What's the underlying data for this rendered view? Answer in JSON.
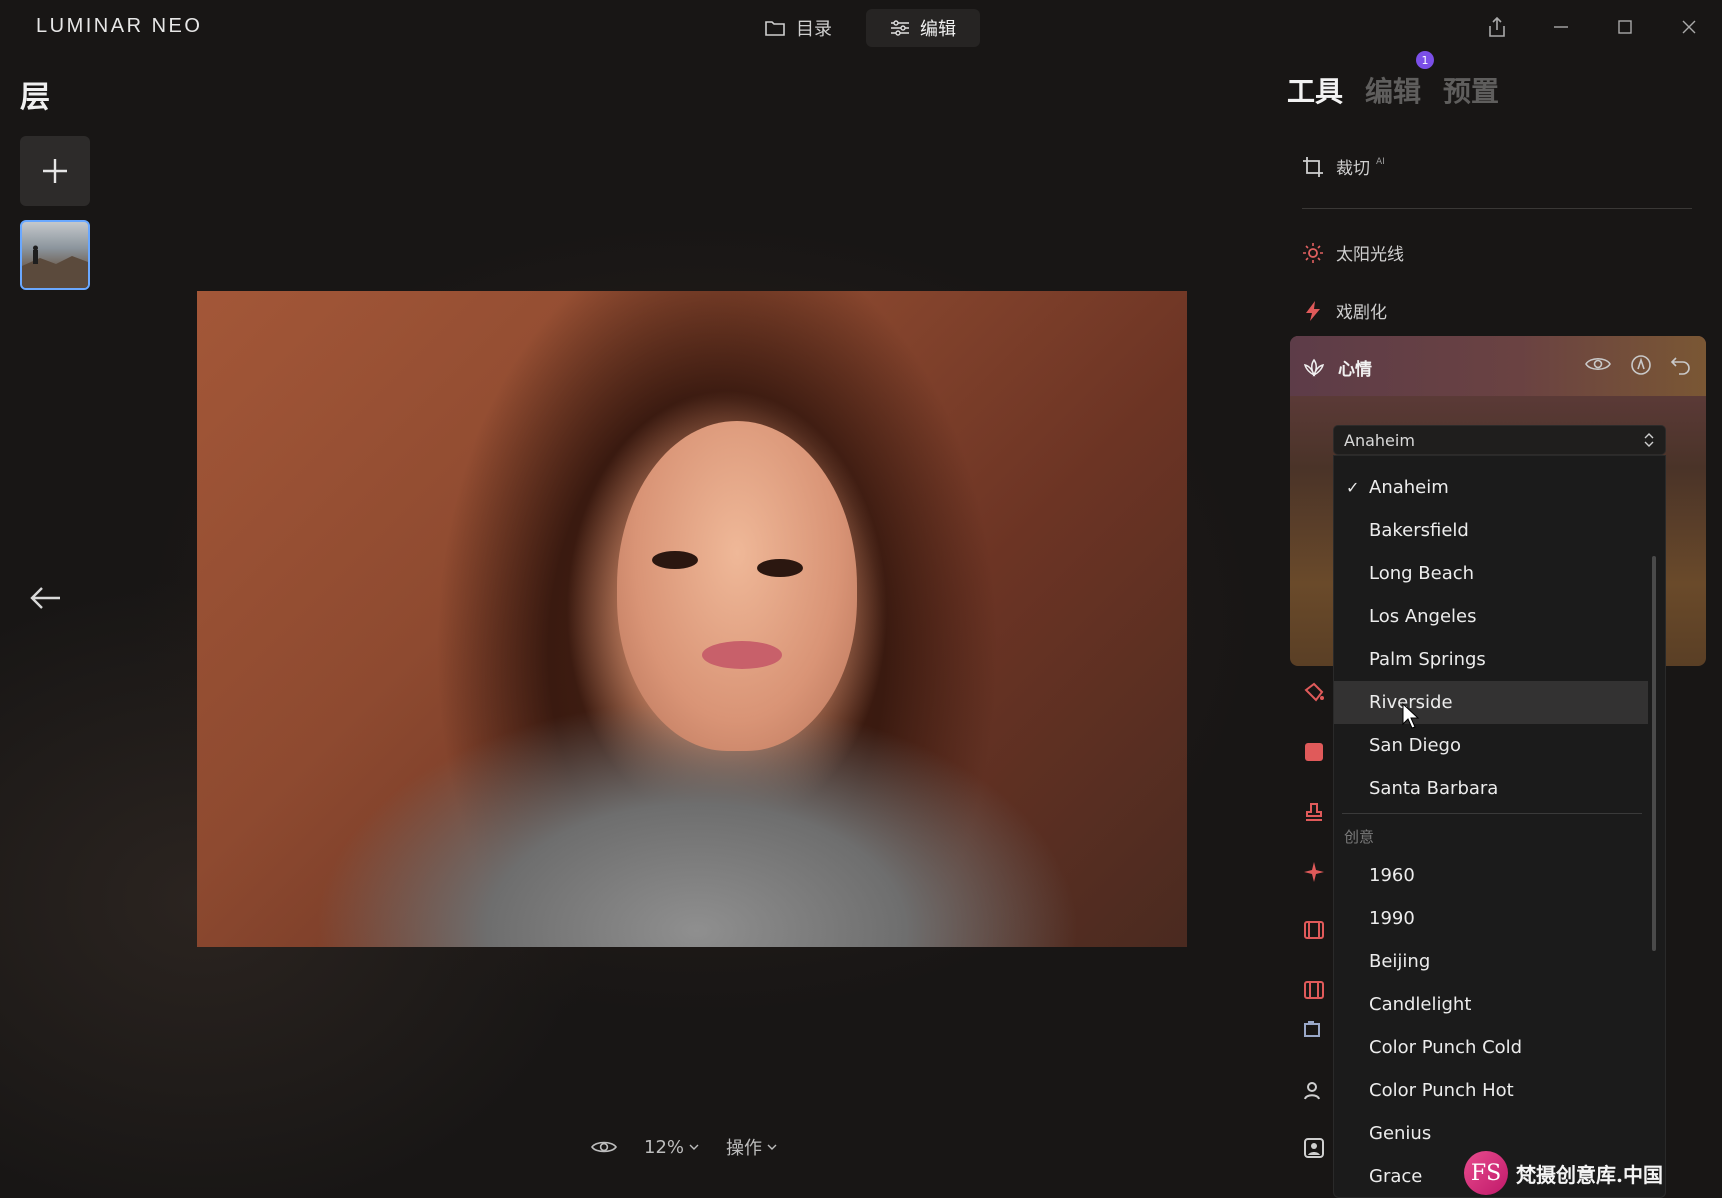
{
  "app": {
    "brand": "LUMINAR NEO"
  },
  "top_nav": [
    {
      "label": "目录",
      "icon": "folder-icon",
      "active": false
    },
    {
      "label": "编辑",
      "icon": "sliders-icon",
      "active": true
    }
  ],
  "window_controls": [
    "share-icon",
    "minimize-icon",
    "maximize-icon",
    "close-icon"
  ],
  "layers": {
    "title": "层",
    "add_icon": "plus-icon"
  },
  "bottom_bar": {
    "zoom": "12%",
    "actions_label": "操作"
  },
  "right_panel": {
    "tabs": [
      {
        "label": "工具",
        "active": true
      },
      {
        "label": "编辑",
        "active": false
      },
      {
        "label": "预置",
        "active": false
      }
    ],
    "badge": "1",
    "tools": [
      {
        "label": "裁切",
        "sup": "AI",
        "icon": "crop-icon"
      },
      {
        "label": "太阳光线",
        "icon": "sun-icon"
      },
      {
        "label": "戏剧化",
        "icon": "lightning-icon"
      }
    ],
    "mood": {
      "title": "心情",
      "icon": "lotus-icon",
      "selected": "Anaheim",
      "options": [
        "Anaheim",
        "Bakersfield",
        "Long Beach",
        "Los Angeles",
        "Palm Springs",
        "Riverside",
        "San Diego",
        "Santa Barbara"
      ],
      "hovered": "Riverside",
      "group_label": "创意",
      "creative_options": [
        "1960",
        "1990",
        "Beijing",
        "Candlelight",
        "Color Punch Cold",
        "Color Punch Hot",
        "Genius",
        "Grace"
      ]
    }
  },
  "watermark": {
    "logo": "FS",
    "text": "梵摄创意库.中国"
  }
}
